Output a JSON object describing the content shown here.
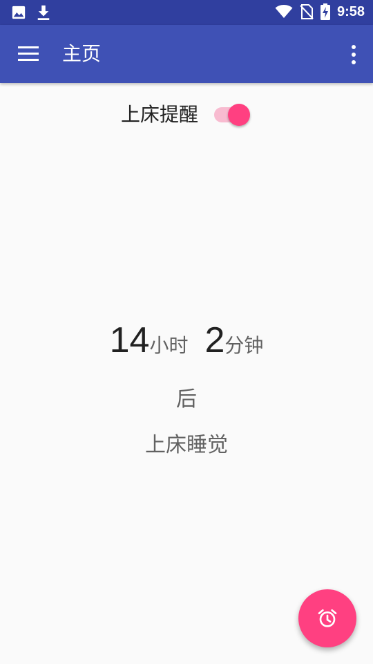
{
  "status_bar": {
    "time": "9:58",
    "icons": [
      "image-icon",
      "download-icon",
      "wifi-icon",
      "no-sim-icon",
      "battery-charging-icon"
    ]
  },
  "app_bar": {
    "title": "主页",
    "menu_icon": "hamburger-menu-icon",
    "overflow_icon": "more-vert-icon"
  },
  "reminder_toggle": {
    "label": "上床提醒",
    "enabled": true
  },
  "countdown": {
    "hours": "14",
    "hours_unit": "小时",
    "minutes": "2",
    "minutes_unit": "分钟",
    "suffix": "后",
    "action": "上床睡觉"
  },
  "fab": {
    "icon": "alarm-icon"
  },
  "colors": {
    "status_bar": "#303f9f",
    "app_bar": "#3f51b5",
    "accent": "#ff4081",
    "accent_light": "#f8bbd0",
    "background": "#fafafa"
  }
}
